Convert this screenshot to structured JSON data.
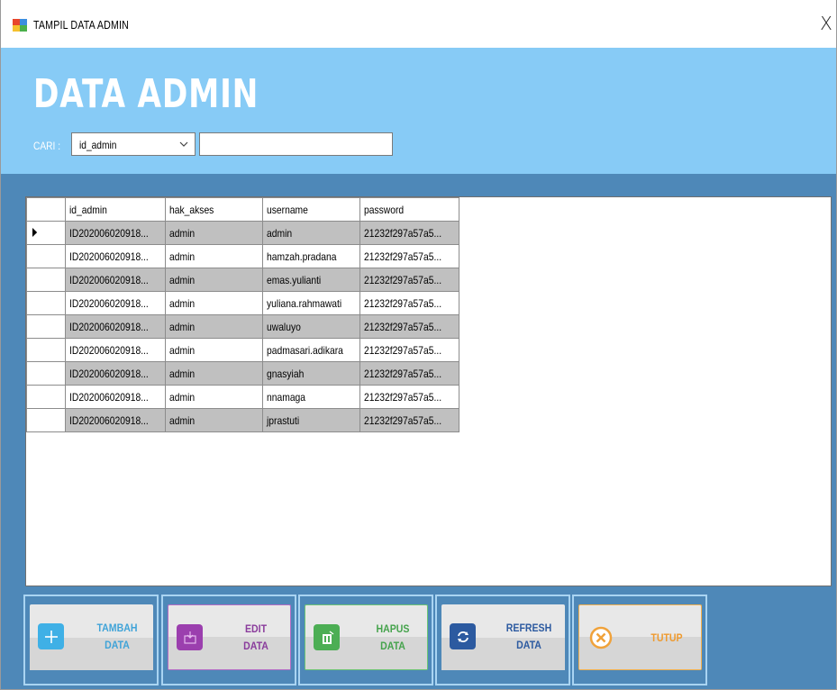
{
  "window": {
    "title": "TAMPIL DATA ADMIN",
    "close_glyph": "X"
  },
  "header": {
    "title": "DATA ADMIN",
    "search_label": "CARI :",
    "search_field_selected": "id_admin",
    "search_value": ""
  },
  "grid": {
    "columns": [
      "id_admin",
      "hak_akses",
      "username",
      "password"
    ],
    "selected_row": 0,
    "rows": [
      [
        "ID202006020918...",
        "admin",
        "admin",
        "21232f297a57a5..."
      ],
      [
        "ID202006020918...",
        "admin",
        "hamzah.pradana",
        "21232f297a57a5..."
      ],
      [
        "ID202006020918...",
        "admin",
        "emas.yulianti",
        "21232f297a57a5..."
      ],
      [
        "ID202006020918...",
        "admin",
        "yuliana.rahmawati",
        "21232f297a57a5..."
      ],
      [
        "ID202006020918...",
        "admin",
        "uwaluyo",
        "21232f297a57a5..."
      ],
      [
        "ID202006020918...",
        "admin",
        "padmasari.adikara",
        "21232f297a57a5..."
      ],
      [
        "ID202006020918...",
        "admin",
        "gnasyiah",
        "21232f297a57a5..."
      ],
      [
        "ID202006020918...",
        "admin",
        "nnamaga",
        "21232f297a57a5..."
      ],
      [
        "ID202006020918...",
        "admin",
        "jprastuti",
        "21232f297a57a5..."
      ]
    ]
  },
  "buttons": [
    {
      "id": "tambah",
      "line1": "TAMBAH",
      "line2": "DATA",
      "icon": "plus-icon",
      "icon_color": "#3fb0e6",
      "text_color": "#3fa3d8"
    },
    {
      "id": "edit",
      "line1": "EDIT",
      "line2": "DATA",
      "icon": "edit-icon",
      "icon_color": "#9b3fae",
      "text_color": "#8a3c9c",
      "border_color": "#b36cc5"
    },
    {
      "id": "hapus",
      "line1": "HAPUS",
      "line2": "DATA",
      "icon": "trash-icon",
      "icon_color": "#4cae54",
      "text_color": "#45a34c",
      "border_color": "#6cc474"
    },
    {
      "id": "refresh",
      "line1": "REFRESH",
      "line2": "DATA",
      "icon": "refresh-icon",
      "icon_color": "#2c5aa0",
      "text_color": "#2c5aa0"
    },
    {
      "id": "tutup",
      "line1": "TUTUP",
      "line2": "",
      "icon": "close-circle-icon",
      "icon_color": "#f0a23a",
      "text_color": "#ef9a2e",
      "border_color": "#f2b04d"
    }
  ],
  "colors": {
    "header_bg": "#87cbf6",
    "frame_bg": "#4e88b8",
    "row_shade": "#c0c0c0"
  }
}
